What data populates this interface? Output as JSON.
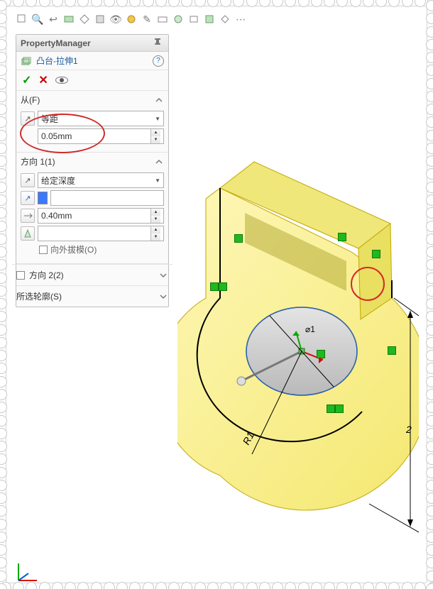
{
  "panel": {
    "title": "PropertyManager",
    "feature_name": "凸台-拉伸1"
  },
  "from_section": {
    "label": "从(F)",
    "start_condition": "等距",
    "offset": "0.05mm"
  },
  "dir1_section": {
    "label": "方向 1(1)",
    "end_condition": "给定深度",
    "depth": "0.40mm",
    "draft_label": "向外拔模(O)"
  },
  "dir2_section": {
    "label": "方向 2(2)"
  },
  "contours_section": {
    "label": "所选轮廓(S)"
  },
  "dims": {
    "radius": "R1",
    "diameter": "⌀1",
    "height": "2",
    "edge": "2"
  }
}
